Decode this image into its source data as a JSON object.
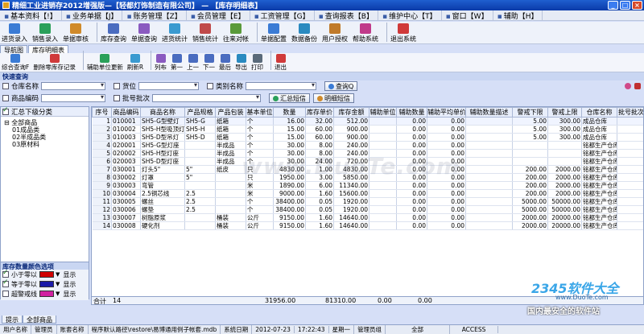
{
  "window": {
    "title": "精细工业进销存2012增强版—【轻都灯饰制造有限公司】 — 【库存明细表】"
  },
  "menu": [
    {
      "label": "基本资料【!】",
      "icon": "document-icon"
    },
    {
      "label": "业务单据【J】",
      "icon": "document-icon"
    },
    {
      "label": "账务管理【Z】",
      "icon": "document-icon"
    },
    {
      "label": "会员管理【E】",
      "icon": "document-icon"
    },
    {
      "label": "工资管理【G】",
      "icon": "document-icon"
    },
    {
      "label": "查询报表【B】",
      "icon": "document-icon"
    },
    {
      "label": "维护中心【T】",
      "icon": "document-icon"
    },
    {
      "label": "窗口【W】",
      "icon": "document-icon"
    },
    {
      "label": "辅助【H】",
      "icon": "document-icon"
    }
  ],
  "toolbar": [
    {
      "label": "进货录入",
      "color": "#3a7bd5"
    },
    {
      "label": "销售录入",
      "color": "#2aa05a"
    },
    {
      "label": "单据审核",
      "color": "#d08a2a"
    },
    {
      "label": "库存查询",
      "color": "#4a6cc0"
    },
    {
      "label": "单据查询",
      "color": "#8a5ac0"
    },
    {
      "label": "进货统计",
      "color": "#3a9ad0"
    },
    {
      "label": "销售统计",
      "color": "#c04a4a"
    },
    {
      "label": "往来对帐",
      "color": "#5a9a3a"
    },
    {
      "label": "单据配置",
      "color": "#3a7bd5"
    },
    {
      "label": "数据备份",
      "color": "#2a8ac0"
    },
    {
      "label": "用户授权",
      "color": "#c07a2a"
    },
    {
      "label": "帮助系统",
      "color": "#c03a8a"
    },
    {
      "label": "退出系统",
      "color": "#d03a3a"
    }
  ],
  "nav_tabs": [
    "导航图",
    "库存明细表"
  ],
  "toolbar2": [
    {
      "label": "综合查询F",
      "color": "#3a7bd5"
    },
    {
      "label": "删除零库存记录",
      "color": "#d03a3a"
    },
    {
      "label": "辅助单位更新",
      "color": "#2aa05a"
    },
    {
      "label": "刷新R",
      "color": "#3a9ad0"
    },
    {
      "label": "列布",
      "color": "#8a5ac0"
    },
    {
      "label": "第一",
      "color": "#4a6cc0"
    },
    {
      "label": "上一",
      "color": "#4a6cc0"
    },
    {
      "label": "下一",
      "color": "#4a6cc0"
    },
    {
      "label": "最后",
      "color": "#4a6cc0"
    },
    {
      "label": "导出",
      "color": "#2a8ac0"
    },
    {
      "label": "打印",
      "color": "#5a6a7a"
    },
    {
      "label": "退出",
      "color": "#d03a3a"
    }
  ],
  "quick_query": {
    "title": "快速查询",
    "warehouse_label": "仓库名称",
    "shelf_label": "货位",
    "category_label": "类别名称",
    "goods_code_label": "商品编码",
    "batch_label": "批号批次",
    "query_button": "查询Q",
    "summary_sms_button": "汇总短信",
    "detail_sms_button": "明细短信"
  },
  "left_panel": {
    "summary_check_label": "汇总下级分类",
    "tree_root": "全部商品",
    "tree_children": [
      "01成品类",
      "02半成品类",
      "03原材料"
    ],
    "color_title": "库存数量颜色选项",
    "color_options": [
      {
        "label": "小于零以",
        "color": "#d00000",
        "action": "显示"
      },
      {
        "label": "等于零以",
        "color": "#1a1aa8",
        "action": "显示"
      },
      {
        "label": "超警戒线",
        "color": "#d020a0",
        "action": "显示"
      }
    ]
  },
  "table": {
    "headers": [
      "序号",
      "商品编码",
      "商品名称",
      "产品规格",
      "产品包装",
      "基本单位",
      "数量",
      "库存单价",
      "库存金额",
      "辅助单位",
      "辅助数量",
      "辅助平均单价",
      "辅助数量描述",
      "警戒下限",
      "警戒上限",
      "仓库名称",
      "批号批次"
    ],
    "rows": [
      [
        "1",
        "010001",
        "SH5-G型壁灯",
        "SH5-G",
        "纸箱",
        "个",
        "16.00",
        "32.00",
        "512.00",
        "",
        "0.00",
        "0.00",
        "",
        "5.00",
        "300.00",
        "成品仓库",
        ""
      ],
      [
        "2",
        "010002",
        "SH5-H型吸顶灯",
        "SH5-H",
        "纸箱",
        "个",
        "15.00",
        "60.00",
        "900.00",
        "",
        "0.00",
        "0.00",
        "",
        "5.00",
        "300.00",
        "成品仓库",
        ""
      ],
      [
        "3",
        "010003",
        "SH5-D型吊灯",
        "SH5-D",
        "纸箱",
        "个",
        "15.00",
        "60.00",
        "900.00",
        "",
        "0.00",
        "0.00",
        "",
        "5.00",
        "300.00",
        "成品仓库",
        ""
      ],
      [
        "4",
        "020001",
        "SH5-G型灯座",
        "",
        "半成品",
        "个",
        "30.00",
        "8.00",
        "240.00",
        "",
        "0.00",
        "0.00",
        "",
        "",
        "",
        "铭都生产仓库",
        ""
      ],
      [
        "5",
        "020002",
        "SH5-H型灯座",
        "",
        "半成品",
        "个",
        "30.00",
        "8.00",
        "240.00",
        "",
        "0.00",
        "0.00",
        "",
        "",
        "",
        "铭都生产仓库",
        ""
      ],
      [
        "6",
        "020003",
        "SH5-D型灯座",
        "",
        "半成品",
        "个",
        "30.00",
        "24.00",
        "720.00",
        "",
        "0.00",
        "0.00",
        "",
        "",
        "",
        "铭都生产仓库",
        ""
      ],
      [
        "7",
        "030001",
        "灯头5\"",
        "5\"",
        "纸皮",
        "只",
        "4830.00",
        "1.00",
        "4830.00",
        "",
        "0.00",
        "0.00",
        "",
        "200.00",
        "2000.00",
        "铭都生产仓库",
        ""
      ],
      [
        "8",
        "030002",
        "灯罩",
        "5\"",
        "",
        "只",
        "1950.00",
        "3.00",
        "5850.00",
        "",
        "0.00",
        "0.00",
        "",
        "200.00",
        "2000.00",
        "铭都生产仓库",
        ""
      ],
      [
        "9",
        "030003",
        "弯管",
        "",
        "",
        "米",
        "1890.00",
        "6.00",
        "11340.00",
        "",
        "0.00",
        "0.00",
        "",
        "200.00",
        "2000.00",
        "铭都生产仓库",
        ""
      ],
      [
        "10",
        "030004",
        "2.5铜芯线",
        "2.5",
        "",
        "米",
        "9000.00",
        "1.60",
        "15600.00",
        "",
        "0.00",
        "0.00",
        "",
        "200.00",
        "2000.00",
        "铭都生产仓库",
        ""
      ],
      [
        "11",
        "030005",
        "螺丝",
        "2.5",
        "",
        "个",
        "38400.00",
        "0.05",
        "1920.00",
        "",
        "0.00",
        "0.00",
        "",
        "5000.00",
        "50000.00",
        "铭都生产仓库",
        ""
      ],
      [
        "12",
        "030006",
        "螺垫",
        "2.5",
        "",
        "个",
        "38400.00",
        "0.05",
        "1920.00",
        "",
        "0.00",
        "0.00",
        "",
        "5000.00",
        "50000.00",
        "铭都生产仓库",
        ""
      ],
      [
        "13",
        "030007",
        "树脂原浆",
        "",
        "桶装",
        "公斤",
        "9150.00",
        "1.60",
        "14640.00",
        "",
        "0.00",
        "0.00",
        "",
        "2000.00",
        "20000.00",
        "铭都生产仓库",
        ""
      ],
      [
        "14",
        "030008",
        "硬化剂",
        "",
        "桶装",
        "公斤",
        "9150.00",
        "1.60",
        "14640.00",
        "",
        "0.00",
        "0.00",
        "",
        "2000.00",
        "20000.00",
        "铭都生产仓库",
        ""
      ]
    ],
    "totals": {
      "label": "合计",
      "count": "14",
      "quantity": "31956.00",
      "amount": "81310.00",
      "aux_qty": "0.00",
      "aux_price": "0.00"
    }
  },
  "watermarks": {
    "center": "www.DuoTe.com",
    "brand": "2345软件大全",
    "brand_url": "www.DuoTe.com",
    "slogan": "国内最安全的软件站"
  },
  "bottom_tabs": [
    "提示",
    "全部商品"
  ],
  "status": {
    "user_label": "用户名称",
    "user": "管理员",
    "account_label": "账套名称",
    "account": "程序默认路径\\restore\\易博通用例子帐套.mdb",
    "date_label": "系统日期",
    "date": "2012-07-23",
    "time": "17:22:43",
    "weekday": "星期一",
    "role": "管理员组",
    "scope": "全部",
    "db": "ACCESS"
  }
}
